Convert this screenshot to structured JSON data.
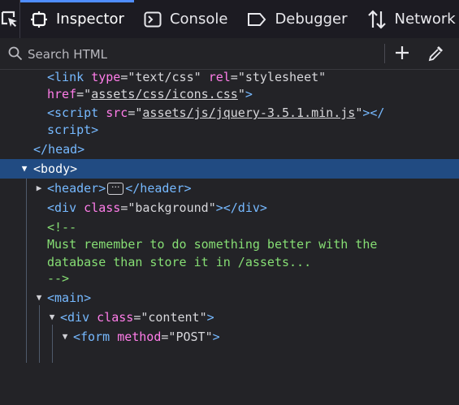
{
  "toolbar": {
    "picker": "element-picker",
    "tabs": [
      {
        "label": "Inspector",
        "icon": "inspector-icon"
      },
      {
        "label": "Console",
        "icon": "console-icon"
      },
      {
        "label": "Debugger",
        "icon": "debugger-icon"
      },
      {
        "label": "Network",
        "icon": "network-icon"
      }
    ],
    "selected_tab": "Inspector",
    "accent_color": "#4f8dff"
  },
  "search": {
    "placeholder": "Search HTML",
    "add_node_icon": "plus-icon",
    "eyedropper_icon": "eyedropper-icon"
  },
  "tree": {
    "selected_color": "#214b82",
    "lines": [
      {
        "type": "link-1",
        "text": "<link type=\"text/css\" rel=\"stylesheet\""
      },
      {
        "type": "link-2",
        "text": "href=\"assets/css/icons.css\">"
      },
      {
        "type": "script-1",
        "text": "<script src=\"assets/js/jquery-3.5.1.min.js\"></"
      },
      {
        "type": "script-2",
        "text": "script>"
      },
      {
        "type": "head-close",
        "text": "</head>"
      },
      {
        "type": "body-open",
        "text": "<body>"
      },
      {
        "type": "header",
        "text": "<header>…</header>"
      },
      {
        "type": "div",
        "text": "<div class=\"background\"></div>"
      },
      {
        "type": "comment-open",
        "text": "<!--"
      },
      {
        "type": "comment-1",
        "text": "Must remember to do something better with the"
      },
      {
        "type": "comment-2",
        "text": "database than store it in /assets..."
      },
      {
        "type": "comment-close",
        "text": "-->"
      },
      {
        "type": "main",
        "text": "<main>"
      },
      {
        "type": "content",
        "text": "<div class=\"content\">"
      },
      {
        "type": "form",
        "text": "<form method=\"POST\">"
      }
    ],
    "link_type": "text/css",
    "link_rel": "stylesheet",
    "link_href": "assets/css/icons.css",
    "script_src": "assets/js/jquery-3.5.1.min.js",
    "div_class": "background",
    "comment_open": "<!--",
    "comment_line1": "Must remember to do something better with the",
    "comment_line2": "database than store it in /assets...",
    "comment_close": "-->",
    "content_class": "content",
    "form_method": "POST",
    "colors": {
      "tag": "#76b9ff",
      "attr": "#ff7de9",
      "comment": "#86de74"
    }
  }
}
